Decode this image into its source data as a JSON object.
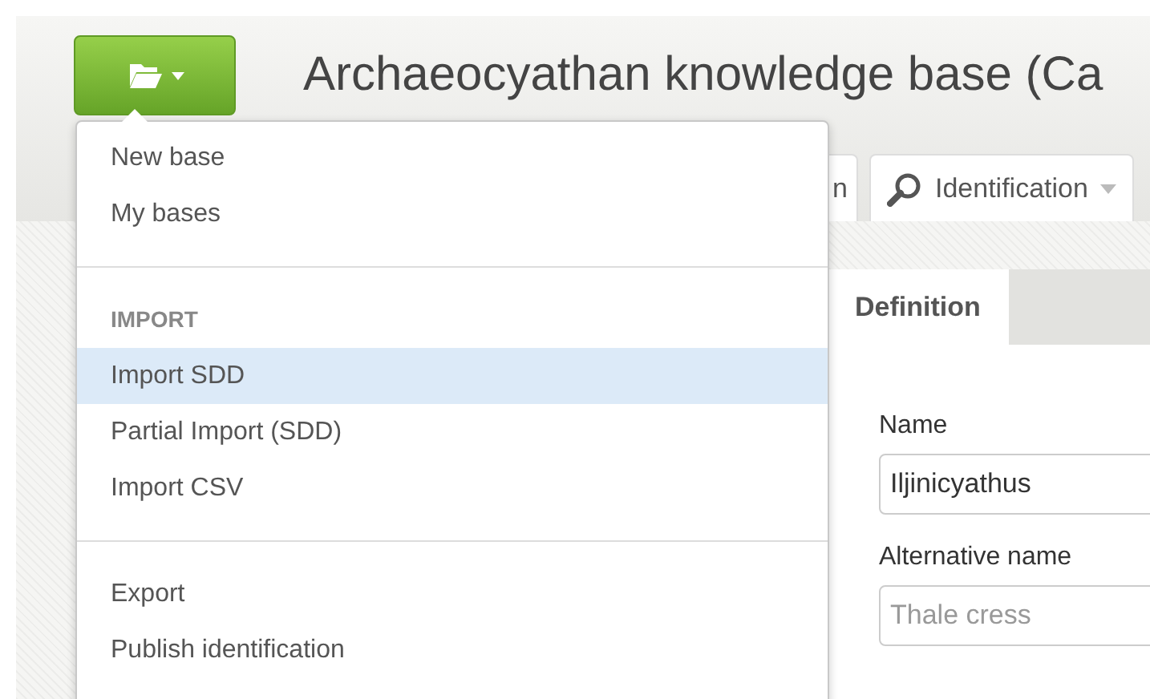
{
  "title": "Archaeocyathan knowledge base (Ca",
  "nav_tabs": [
    {
      "label": "n",
      "kind": "plain"
    },
    {
      "label": "Identification",
      "kind": "dropdown"
    }
  ],
  "menu": {
    "sections": [
      {
        "items": [
          {
            "label": "New base",
            "selected": false
          },
          {
            "label": "My bases",
            "selected": false
          }
        ]
      },
      {
        "heading": "IMPORT",
        "items": [
          {
            "label": "Import SDD",
            "selected": true
          },
          {
            "label": "Partial Import (SDD)",
            "selected": false
          },
          {
            "label": "Import CSV",
            "selected": false
          }
        ]
      },
      {
        "items": [
          {
            "label": "Export",
            "selected": false
          },
          {
            "label": "Publish identification",
            "selected": false
          }
        ]
      }
    ]
  },
  "panel_tabs": [
    {
      "label": "Definition",
      "selected": true
    }
  ],
  "form": {
    "fields": [
      {
        "label": "Name",
        "value": "Iljinicyathus"
      },
      {
        "label": "Alternative name",
        "placeholder": "Thale cress"
      }
    ]
  }
}
